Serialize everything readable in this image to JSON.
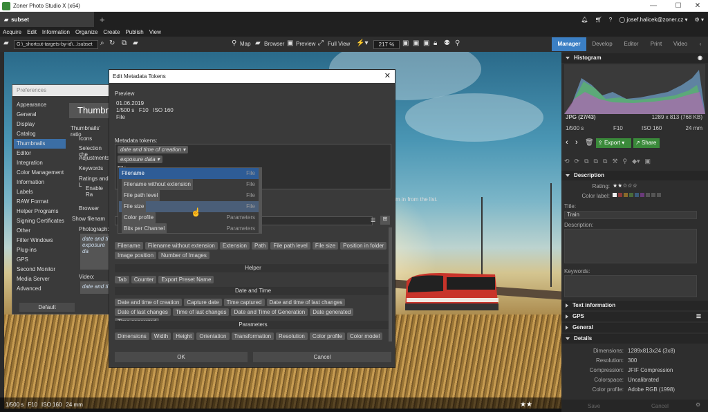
{
  "app": {
    "title": "Zoner Photo Studio X (x64)",
    "tab": "subset",
    "user": "josef.halicek@zoner.cz"
  },
  "menu": [
    "Acquire",
    "Edit",
    "Information",
    "Organize",
    "Create",
    "Publish",
    "View"
  ],
  "toolbar": {
    "path": "G:\\_shortcut-targets-by-id\\...\\subset",
    "map": "Map",
    "browser": "Browser",
    "preview": "Preview",
    "fullview": "Full View",
    "zoom": "217 %"
  },
  "modes": [
    "Manager",
    "Develop",
    "Editor",
    "Print",
    "Video"
  ],
  "photo": {
    "status_exposure": "1/500 s",
    "status_f": "F10",
    "status_iso": "ISO 160",
    "status_focal": "24 mm",
    "stars": "★★"
  },
  "prefs": {
    "title": "Preferences",
    "heading": "Thumbnails",
    "items": [
      "Appearance",
      "General",
      "Display",
      "Catalog",
      "Thumbnails",
      "Editor",
      "Integration",
      "Color Management",
      "Information",
      "Labels",
      "RAW Format",
      "Helper Programs",
      "Signing Certificates",
      "Other",
      "Filter Windows",
      "Plug-ins",
      "GPS",
      "Second Monitor",
      "Media Server",
      "Advanced"
    ],
    "selected_index": 4,
    "default_button": "Default",
    "right_texts": [
      "Thumbnails' ratio",
      "Icons",
      "Selection che",
      "Adjustments",
      "Keywords",
      "Ratings and L",
      "Enable Ra",
      "Browser",
      "Show filenam",
      "Photograph:",
      "Video:"
    ],
    "photo_tokens": [
      "date and ti",
      "exposure da"
    ],
    "video_token": "date and ti",
    "list_suffix": "m in from the list."
  },
  "dialog": {
    "title": "Edit Metadata Tokens",
    "preview_label": "Preview",
    "preview_lines": [
      "01.06.2019",
      "1/500 s   F10   ISO 160",
      "File"
    ],
    "tokens_label": "Metadata tokens:",
    "tokens": [
      "date and time of creation ▾",
      "exposure data ▾"
    ],
    "token_text": "File",
    "file_chips": [
      "Filename",
      "Filename without extension",
      "Extension",
      "Path",
      "File path level",
      "File size",
      "Position in folder",
      "Image position",
      "Number of Images"
    ],
    "helper_title": "Helper",
    "helper_chips": [
      "Tab",
      "Counter",
      "Export Preset Name"
    ],
    "datetime_title": "Date and Time",
    "datetime_chips": [
      "Date and time of creation",
      "Capture date",
      "Time captured",
      "Date and time of last changes",
      "Date of last changes",
      "Time of last changes",
      "Date and Time of Generation",
      "Date generated",
      "Time generated"
    ],
    "params_title": "Parameters",
    "params_chips": [
      "Dimensions",
      "Width",
      "Height",
      "Orientation",
      "Transformation",
      "Resolution",
      "Color profile",
      "Color model"
    ],
    "ok": "OK",
    "cancel": "Cancel"
  },
  "dropdown": [
    {
      "label": "Filename",
      "kind": "File"
    },
    {
      "label": "Filename without extension",
      "kind": "File"
    },
    {
      "label": "File path level",
      "kind": "File"
    },
    {
      "label": "File size",
      "kind": "File"
    },
    {
      "label": "Color profile",
      "kind": "Parameters"
    },
    {
      "label": "Bits per Channel",
      "kind": "Parameters"
    }
  ],
  "panel": {
    "histogram": "Histogram",
    "format": "JPG (27/43)",
    "dims": "1289 x 813 (768 KB)",
    "exp": "1/500 s",
    "f": "F10",
    "iso": "ISO 160",
    "focal": "24 mm",
    "export": "Export",
    "share": "Share",
    "description": "Description",
    "rating_label": "Rating:",
    "rating": "★★☆☆☆",
    "colorlabel_label": "Color label:",
    "title_label": "Title:",
    "title_value": "Train",
    "desc_label": "Description:",
    "keywords_label": "Keywords:",
    "text_info": "Text information",
    "gps": "GPS",
    "general": "General",
    "details": "Details",
    "details_rows": [
      {
        "k": "Dimensions:",
        "v": "1289x813x24 (3x8)"
      },
      {
        "k": "Resolution:",
        "v": "300"
      },
      {
        "k": "Compression:",
        "v": "JFIF Compression"
      },
      {
        "k": "Colorspace:",
        "v": "Uncalibrated"
      },
      {
        "k": "Color profile:",
        "v": "Adobe RGB (1998)"
      }
    ],
    "save": "Save",
    "cancel": "Cancel"
  }
}
